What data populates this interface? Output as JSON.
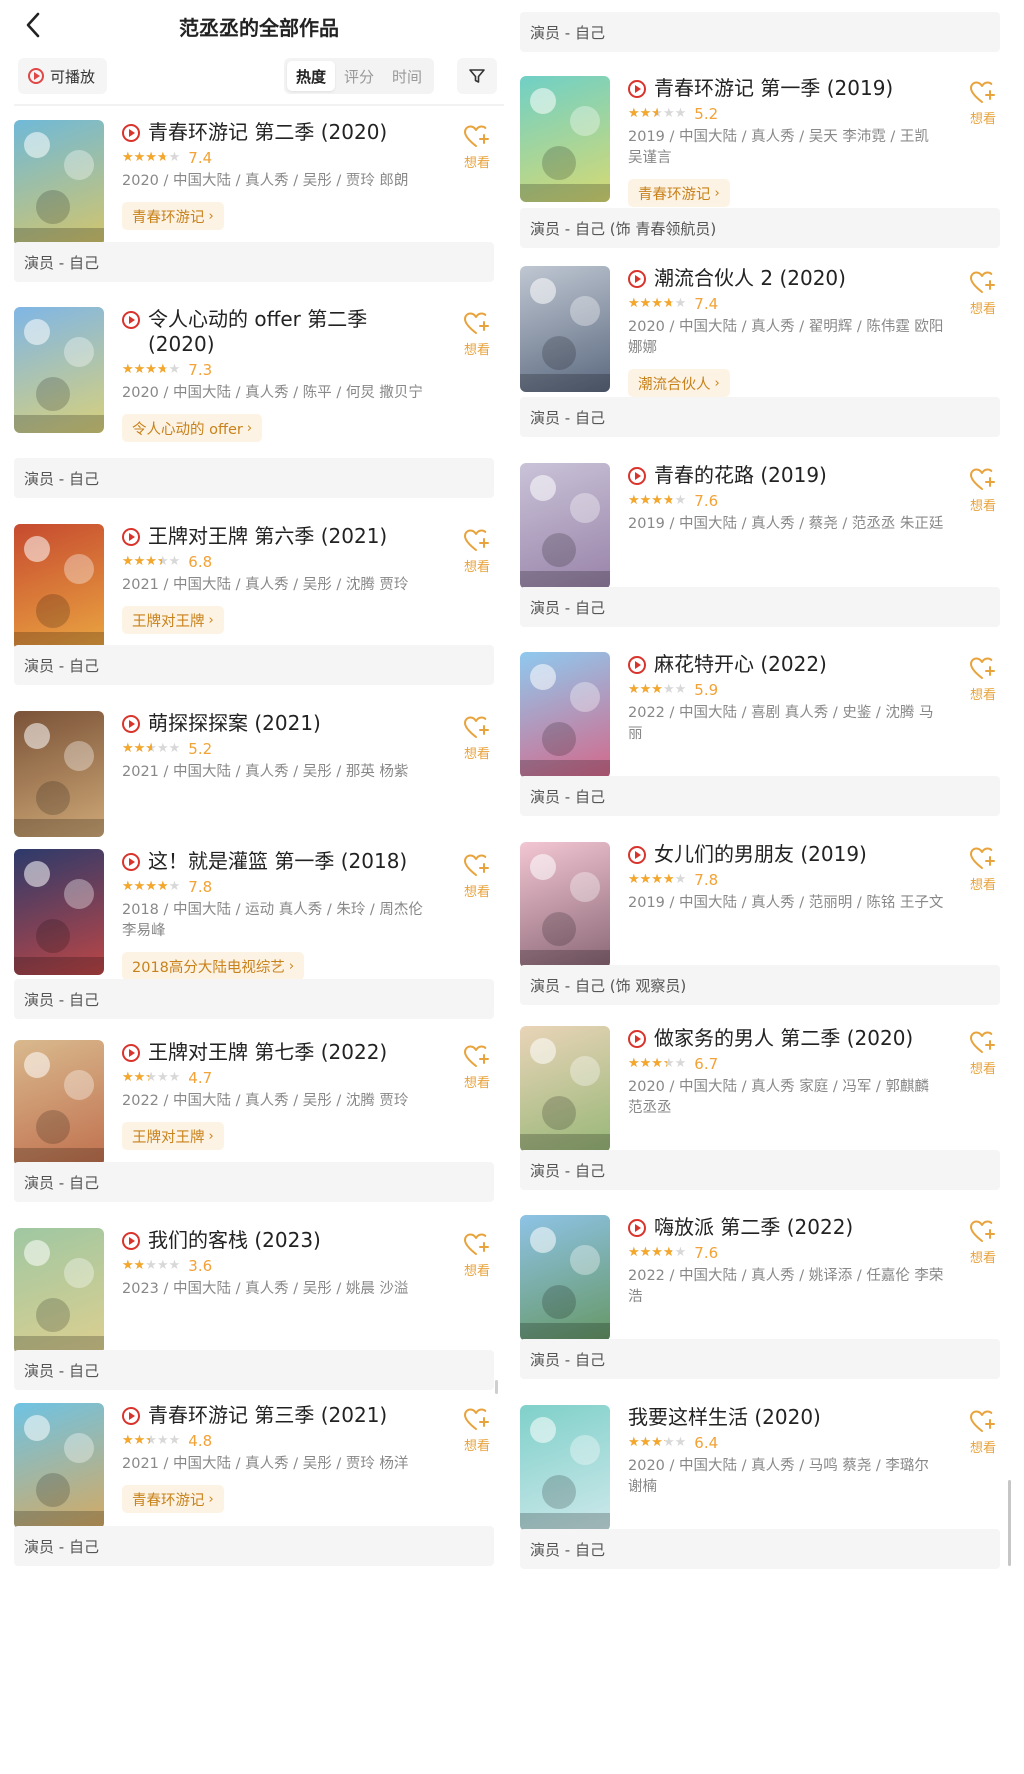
{
  "header": {
    "title": "范丞丞的全部作品"
  },
  "toolbar": {
    "playable_label": "可播放",
    "sort_tabs": [
      {
        "label": "热度",
        "active": true
      },
      {
        "label": "评分",
        "active": false
      },
      {
        "label": "时间",
        "active": false
      }
    ]
  },
  "want_label": "想看",
  "colors": {
    "accent_orange": "#f2a236",
    "play_red": "#d9342b",
    "tag_bg": "#fdf3e4",
    "tag_text": "#c8821b"
  },
  "left_top_role": "",
  "right_top_role": "演员 - 自己",
  "items_left": [
    {
      "title": "青春环游记 第二季 (2020)",
      "has_play": true,
      "rating": 7.4,
      "score": "7.4",
      "meta": "2020 / 中国大陆 / 真人秀 / 吴彤 / 贾玲 郎朗",
      "tag": "青春环游记",
      "role": "演员 - 自己",
      "poster_color": "#6fb9d8",
      "poster_accent": "#f3c94a"
    },
    {
      "title": "令人心动的 offer 第二季 (2020)",
      "has_play": true,
      "rating": 7.3,
      "score": "7.3",
      "meta": "2020 / 中国大陆 / 真人秀 / 陈平 / 何炅 撒贝宁",
      "tag": "令人心动的 offer",
      "role": "演员 - 自己",
      "poster_color": "#7fb6e6",
      "poster_accent": "#f3d85a"
    },
    {
      "title": "王牌对王牌 第六季 (2021)",
      "has_play": true,
      "rating": 6.8,
      "score": "6.8",
      "meta": "2021 / 中国大陆 / 真人秀 / 吴彤 / 沈腾 贾玲",
      "tag": "王牌对王牌",
      "role": "演员 - 自己",
      "poster_color": "#c64a2f",
      "poster_accent": "#f6c247"
    },
    {
      "title": "萌探探探案 (2021)",
      "has_play": true,
      "rating": 5.2,
      "score": "5.2",
      "meta": "2021 / 中国大陆 / 真人秀 / 吴彤 / 那英 杨紫",
      "tag": "",
      "role": "",
      "poster_color": "#7a5238",
      "poster_accent": "#e8c38a"
    },
    {
      "title": "这！就是灌篮 第一季 (2018)",
      "has_play": true,
      "rating": 7.8,
      "score": "7.8",
      "meta": "2018 / 中国大陆 / 运动 真人秀 / 朱玲 / 周杰伦 李易峰",
      "tag": "2018高分大陆电视综艺",
      "role": "演员 - 自己",
      "poster_color": "#2c3a6b",
      "poster_accent": "#e84a3a"
    },
    {
      "title": "王牌对王牌 第七季 (2022)",
      "has_play": true,
      "rating": 4.7,
      "score": "4.7",
      "meta": "2022 / 中国大陆 / 真人秀 / 吴彤 / 沈腾 贾玲",
      "tag": "王牌对王牌",
      "role": "演员 - 自己",
      "poster_color": "#d9b98e",
      "poster_accent": "#b85a3a"
    },
    {
      "title": "我们的客栈 (2023)",
      "has_play": true,
      "rating": 3.6,
      "score": "3.6",
      "meta": "2023 / 中国大陆 / 真人秀 / 吴彤 / 姚晨 沙溢",
      "tag": "",
      "role": "演员 - 自己",
      "poster_color": "#9fc7a2",
      "poster_accent": "#f0d28a"
    },
    {
      "title": "青春环游记 第三季 (2021)",
      "has_play": true,
      "rating": 4.8,
      "score": "4.8",
      "meta": "2021 / 中国大陆 / 真人秀 / 吴彤 / 贾玲 杨洋",
      "tag": "青春环游记",
      "role": "演员 - 自己",
      "poster_color": "#6ec3e4",
      "poster_accent": "#f4a13a"
    }
  ],
  "items_right": [
    {
      "title": "青春环游记 第一季 (2019)",
      "has_play": true,
      "rating": 5.2,
      "score": "5.2",
      "meta": "2019 / 中国大陆 / 真人秀 / 吴天 李沛霓 / 王凯 吴谨言",
      "tag": "青春环游记",
      "role": "演员 - 自己 (饰 青春领航员)",
      "poster_color": "#6fd0c6",
      "poster_accent": "#f5dc5a"
    },
    {
      "title": "潮流合伙人 2 (2020)",
      "has_play": true,
      "rating": 7.4,
      "score": "7.4",
      "meta": "2020 / 中国大陆 / 真人秀 / 翟明辉 / 陈伟霆 欧阳娜娜",
      "tag": "潮流合伙人",
      "role": "演员 - 自己",
      "poster_color": "#bfc7d2",
      "poster_accent": "#3d4c66"
    },
    {
      "title": "青春的花路 (2019)",
      "has_play": true,
      "rating": 7.6,
      "score": "7.6",
      "meta": "2019 / 中国大陆 / 真人秀 / 蔡尧 / 范丞丞 朱正廷",
      "tag": "",
      "role": "演员 - 自己",
      "poster_color": "#c9c3d8",
      "poster_accent": "#8a6f9a"
    },
    {
      "title": "麻花特开心 (2022)",
      "has_play": true,
      "rating": 5.9,
      "score": "5.9",
      "meta": "2022 / 中国大陆 / 喜剧 真人秀 / 史鉴 / 沈腾 马丽",
      "tag": "",
      "role": "演员 - 自己",
      "poster_color": "#8fc9ef",
      "poster_accent": "#e84a6a"
    },
    {
      "title": "女儿们的男朋友 (2019)",
      "has_play": true,
      "rating": 7.8,
      "score": "7.8",
      "meta": "2019 / 中国大陆 / 真人秀 / 范丽明 / 陈铭 王子文",
      "tag": "",
      "role": "演员 - 自己 (饰 观察员)",
      "poster_color": "#f3c6d3",
      "poster_accent": "#6a4a5a"
    },
    {
      "title": "做家务的男人 第二季 (2020)",
      "has_play": true,
      "rating": 6.7,
      "score": "6.7",
      "meta": "2020 / 中国大陆 / 真人秀 家庭 / 冯军 / 郭麒麟 范丞丞",
      "tag": "",
      "role": "演员 - 自己",
      "poster_color": "#e9d4b8",
      "poster_accent": "#7fae64"
    },
    {
      "title": "嗨放派 第二季 (2022)",
      "has_play": true,
      "rating": 7.6,
      "score": "7.6",
      "meta": "2022 / 中国大陆 / 真人秀 / 姚译添 / 任嘉伦 李荣浩",
      "tag": "",
      "role": "演员 - 自己",
      "poster_color": "#8ec3e6",
      "poster_accent": "#5a8a3e"
    },
    {
      "title": "我要这样生活 (2020)",
      "has_play": false,
      "rating": 6.4,
      "score": "6.4",
      "meta": "2020 / 中国大陆 / 真人秀 / 马鸣 蔡尧 / 李璐尔 谢楠",
      "tag": "",
      "role": "演员 - 自己",
      "poster_color": "#7fd0c9",
      "poster_accent": "#e6f0f6"
    }
  ]
}
